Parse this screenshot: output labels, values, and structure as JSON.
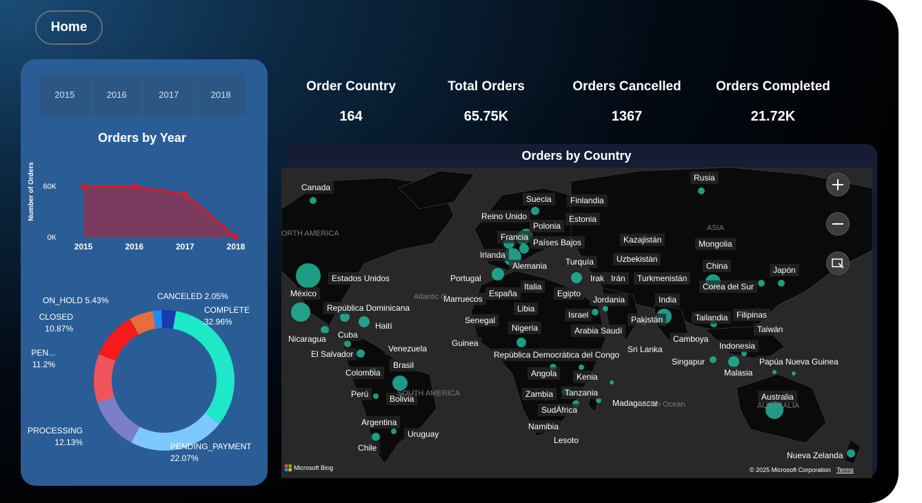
{
  "nav": {
    "home_label": "Home"
  },
  "year_slicer": {
    "years": [
      "2015",
      "2016",
      "2017",
      "2018"
    ]
  },
  "orders_by_year": {
    "title": "Orders by Year",
    "ylabel": "Number of Orders",
    "y_ticks": [
      "60K",
      "0K"
    ]
  },
  "kpis": [
    {
      "label": "Order Country",
      "value": "164"
    },
    {
      "label": "Total Orders",
      "value": "65.75K"
    },
    {
      "label": "Orders Cancelled",
      "value": "1367"
    },
    {
      "label": "Orders Completed",
      "value": "21.72K"
    }
  ],
  "map": {
    "title": "Orders by Country",
    "bing_label": "Microsoft Bing",
    "copyright": "© 2025 Microsoft Corporation",
    "terms": "Terms",
    "ocean_labels": [
      "Atlantic O",
      "Indian Ocean"
    ],
    "region_labels": [
      "ORTH AMERICA",
      "ASIA",
      "SOUTH AMERICA",
      "AUSTRALIA"
    ],
    "countries": [
      "Canada",
      "Rusia",
      "Suecia",
      "Finlandia",
      "Reino Unido",
      "Estonia",
      "Polonia",
      "Francia",
      "Países Bajos",
      "Kazajistán",
      "Mongolia",
      "Irlanda",
      "Alemania",
      "Turquía",
      "Uzbekistán",
      "China",
      "Estados Unidos",
      "Portugal",
      "Italia",
      "Irak",
      "Irán",
      "Turkmenistán",
      "Corea del Sur",
      "Japón",
      "México",
      "España",
      "Egipto",
      "India",
      "Marruecos",
      "Jordania",
      "República Dominicana",
      "Libia",
      "Israel",
      "Pakistán",
      "Tailandia",
      "Filipinas",
      "Haití",
      "Senegal",
      "Nigeria",
      "Arabia Saudí",
      "Taiwán",
      "Cuba",
      "Nicaragua",
      "Camboya",
      "Guinea",
      "Venezuela",
      "Indonesia",
      "El Salvador",
      "Sri Lanka",
      "República Democrática del Congo",
      "Singapur",
      "Papúa Nueva Guinea",
      "Brasil",
      "Colombia",
      "Malasia",
      "Angola",
      "Kenia",
      "Perú",
      "Bolivia",
      "Zambia",
      "Tanzania",
      "Madagascar",
      "Australia",
      "SudÁfrica",
      "Argentina",
      "Namibia",
      "Uruguay",
      "Lesoto",
      "Chile",
      "Nueva Zelanda"
    ]
  },
  "chart_data": [
    {
      "type": "area",
      "title": "Orders by Year",
      "ylabel": "Number of Orders",
      "categories": [
        "2015",
        "2016",
        "2017",
        "2018"
      ],
      "values": [
        62500,
        62600,
        53000,
        200
      ],
      "ylim": [
        0,
        70000
      ],
      "color": "#d81b2a"
    },
    {
      "type": "pie",
      "labels": [
        "COMPLETE",
        "PENDING_PAYMENT",
        "PROCESSING",
        "PEN...",
        "CLOSED",
        "ON_HOLD",
        "CANCELED"
      ],
      "label_text": [
        "COMPLETE",
        "PENDING_PAYMENT",
        "PROCESSING",
        "PEN...",
        "CLOSED",
        "ON_HOLD 5.43%",
        "CANCELED 2.05%"
      ],
      "pct_text": [
        "32.96%",
        "22.07%",
        "12.13%",
        "11.2%",
        "10.87%",
        "",
        ""
      ],
      "values": [
        32.96,
        22.07,
        12.13,
        11.2,
        10.87,
        5.43,
        2.05,
        3.29
      ],
      "colors": [
        "#1de9c8",
        "#7dc8ff",
        "#7b7fc9",
        "#f0545b",
        "#f51b1b",
        "#e86d3c",
        "#1e8cf0",
        "#1a3ab0"
      ]
    }
  ]
}
